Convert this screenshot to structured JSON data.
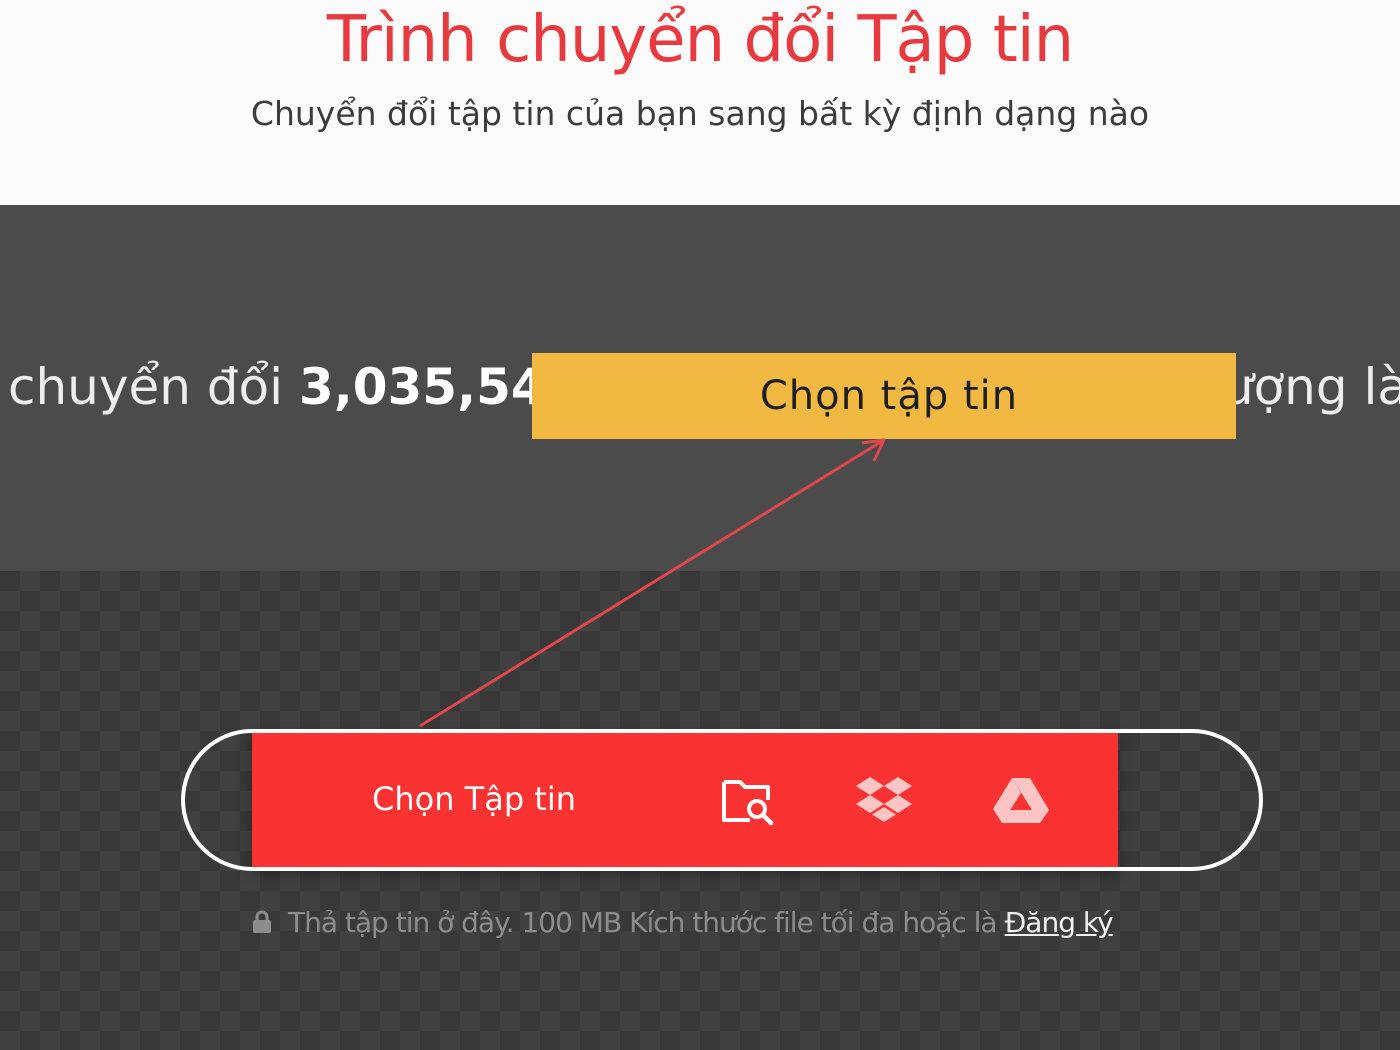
{
  "header": {
    "title": "Trình chuyển đổi Tập tin",
    "subtitle": "Chuyển đổi tập tin của bạn sang bất kỳ định dạng nào"
  },
  "stats": {
    "prefix": "chuyển đổi ",
    "count": "3,035,54",
    "suffix": "ượng là"
  },
  "callout": {
    "label": "Chọn tập tin"
  },
  "upload": {
    "button_label": "Chọn Tập tin",
    "icons": [
      "folder-search-icon",
      "dropbox-icon",
      "google-drive-icon"
    ]
  },
  "drop_note": {
    "text": "Thả tập tin ở đây. 100 MB Kích thước file tối đa hoặc là",
    "link": "Đăng ký"
  },
  "colors": {
    "brand_red": "#fa3232",
    "title_red": "#e8393f",
    "callout_yellow": "#f2b942",
    "arrow_red": "#e0474c"
  }
}
